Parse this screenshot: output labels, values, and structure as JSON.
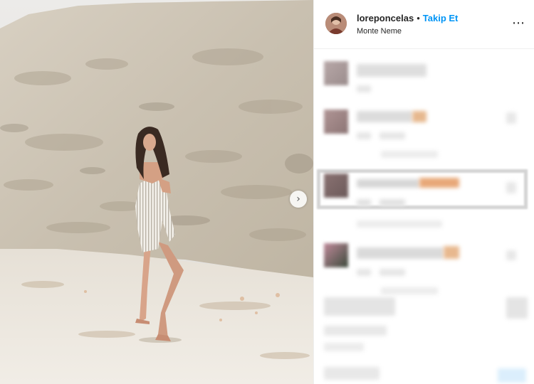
{
  "post": {
    "username": "loreponcelas",
    "separator": "•",
    "follow_label": "Takip Et",
    "location": "Monte Neme",
    "more_icon": "⋯",
    "carousel_next_icon": "›"
  },
  "colors": {
    "follow_blue": "#0095f6",
    "text_dark": "#262626",
    "divider": "#efefef"
  },
  "icons": {
    "avatar": "profile-avatar",
    "more": "more-options-icon",
    "carousel_next": "chevron-right-icon"
  }
}
